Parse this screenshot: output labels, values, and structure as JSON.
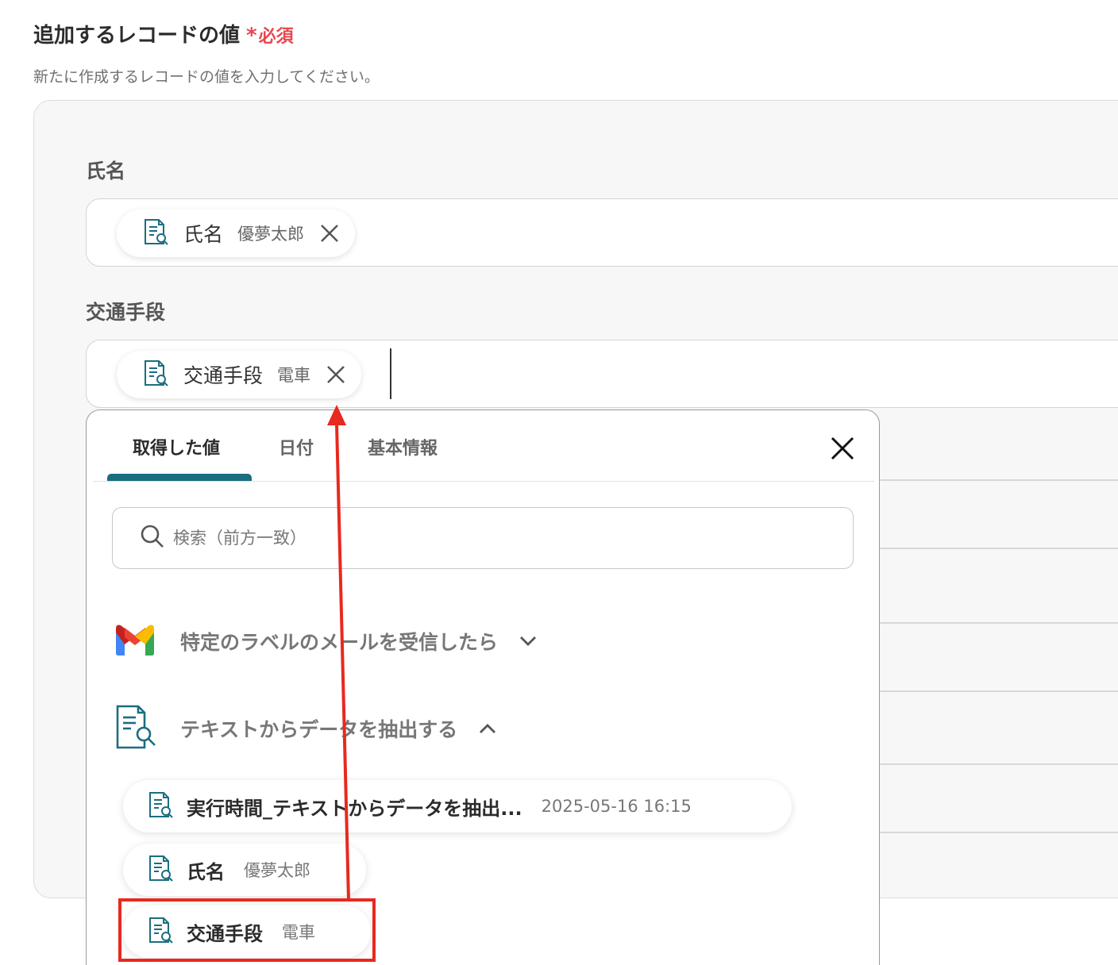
{
  "header": {
    "title": "追加するレコードの値",
    "required_mark": "*",
    "required_text": "必須",
    "description": "新たに作成するレコードの値を入力してください。"
  },
  "fields": [
    {
      "label": "氏名",
      "chip": {
        "name": "氏名",
        "value": "優夢太郎"
      }
    },
    {
      "label": "交通手段",
      "chip": {
        "name": "交通手段",
        "value": "電車"
      }
    }
  ],
  "popup": {
    "tabs": [
      {
        "label": "取得した値",
        "active": true
      },
      {
        "label": "日付",
        "active": false
      },
      {
        "label": "基本情報",
        "active": false
      }
    ],
    "search_placeholder": "検索（前方一致）",
    "groups": [
      {
        "label": "特定のラベルのメールを受信したら",
        "icon": "gmail-icon",
        "expanded": false
      },
      {
        "label": "テキストからデータを抽出する",
        "icon": "document-search-icon",
        "expanded": true
      }
    ],
    "items": [
      {
        "name": "実行時間_テキストからデータを抽出...",
        "value": "2025-05-16 16:15"
      },
      {
        "name": "氏名",
        "value": "優夢太郎"
      },
      {
        "name": "交通手段",
        "value": "電車"
      }
    ]
  },
  "colors": {
    "accent": "#1a6e80",
    "required": "#e8474f",
    "annotation": "#e8291e"
  }
}
